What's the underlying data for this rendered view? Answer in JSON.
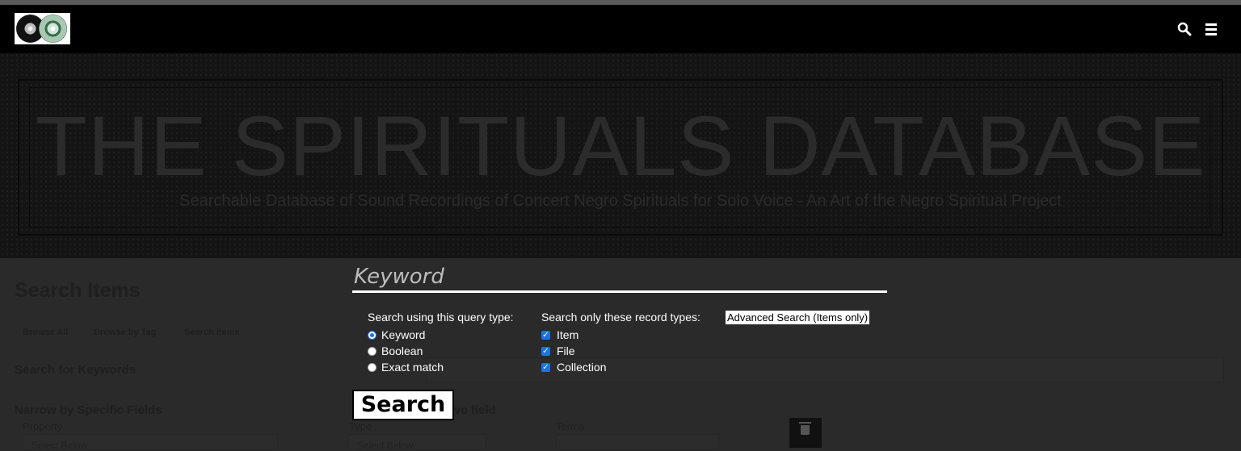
{
  "header": {
    "logo_alt": "The Spirituals Database logo"
  },
  "hero": {
    "title": "THE SPIRITUALS DATABASE",
    "subtitle": "Searchable Database of Sound Recordings of Concert Negro Spirituals for Solo Voice - An Art of the Negro Spiritual Project"
  },
  "page": {
    "title": "Search Items",
    "nav": [
      "Browse All",
      "Browse by Tag",
      "Search Items"
    ],
    "keywords_heading": "Search for Keywords",
    "narrow_heading": "Narrow by Specific Fields",
    "property_label": "Property",
    "property_select": "Select Below",
    "remove_field_fragment": "ve field",
    "type_label": "Type",
    "type_select": "Select Below",
    "terms_label": "Terms"
  },
  "search_popup": {
    "keyword_placeholder": "Keyword",
    "query_type_legend": "Search using this query type:",
    "query_types": [
      "Keyword",
      "Boolean",
      "Exact match"
    ],
    "selected_query_type": "Keyword",
    "record_types_legend": "Search only these record types:",
    "record_types": [
      "Item",
      "File",
      "Collection"
    ],
    "advanced_link": "Advanced Search (Items only)",
    "search_button": "Search"
  },
  "colors": {
    "header_bg": "#000000",
    "accent_check": "#1a73e8",
    "page_bg": "#2a2a2a"
  }
}
